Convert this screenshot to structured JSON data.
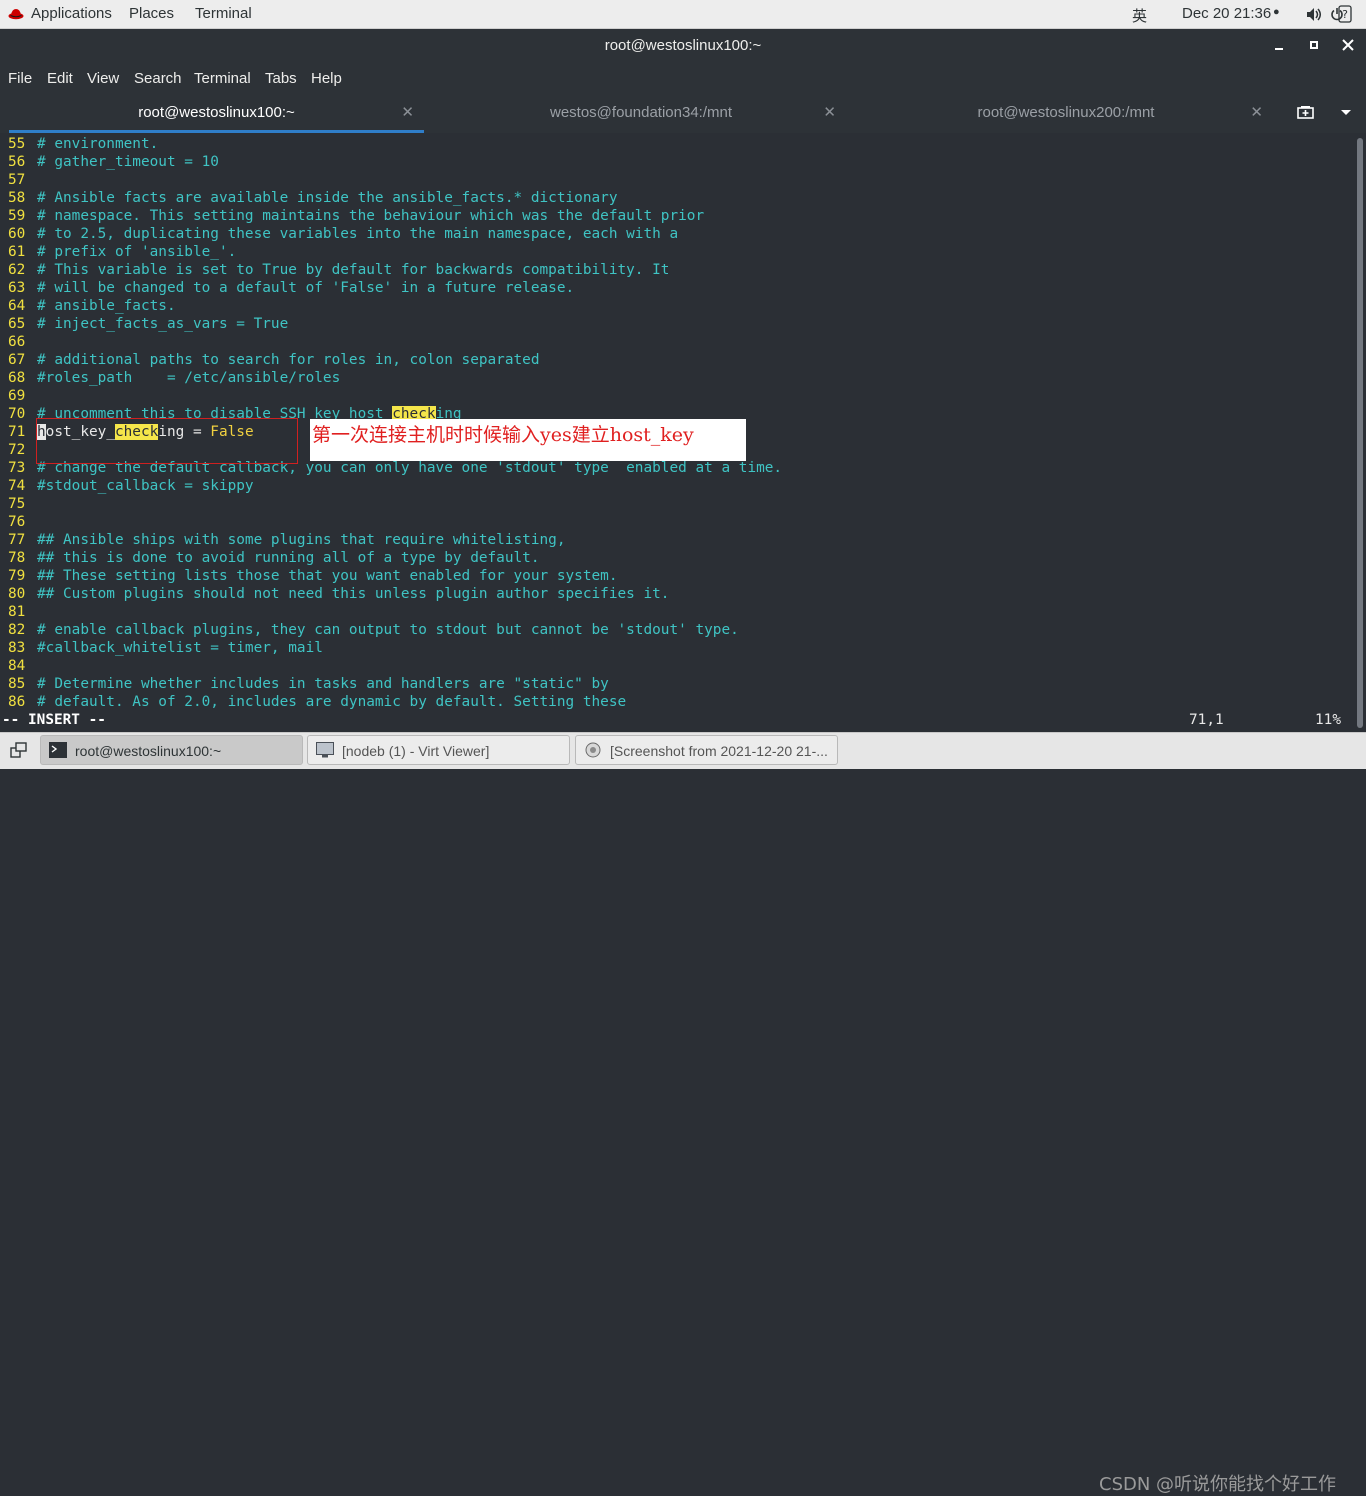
{
  "topbar": {
    "applications": "Applications",
    "places": "Places",
    "terminal": "Terminal",
    "input_method": "英",
    "clock": "Dec 20  21:36",
    "record_dot": "●"
  },
  "window": {
    "title": "root@westoslinux100:~"
  },
  "menu": [
    "File",
    "Edit",
    "View",
    "Search",
    "Terminal",
    "Tabs",
    "Help"
  ],
  "tabs": [
    {
      "label": "root@westoslinux100:~",
      "active": true
    },
    {
      "label": "westos@foundation34:/mnt",
      "active": false
    },
    {
      "label": "root@westoslinux200:/mnt",
      "active": false
    }
  ],
  "editor": {
    "lines": [
      {
        "n": "55",
        "t": "# environment."
      },
      {
        "n": "56",
        "t": "# gather_timeout = 10"
      },
      {
        "n": "57",
        "t": ""
      },
      {
        "n": "58",
        "t": "# Ansible facts are available inside the ansible_facts.* dictionary"
      },
      {
        "n": "59",
        "t": "# namespace. This setting maintains the behaviour which was the default prior"
      },
      {
        "n": "60",
        "t": "# to 2.5, duplicating these variables into the main namespace, each with a"
      },
      {
        "n": "61",
        "t": "# prefix of 'ansible_'."
      },
      {
        "n": "62",
        "t": "# This variable is set to True by default for backwards compatibility. It"
      },
      {
        "n": "63",
        "t": "# will be changed to a default of 'False' in a future release."
      },
      {
        "n": "64",
        "t": "# ansible_facts."
      },
      {
        "n": "65",
        "t": "# inject_facts_as_vars = True"
      },
      {
        "n": "66",
        "t": ""
      },
      {
        "n": "67",
        "t": "# additional paths to search for roles in, colon separated"
      },
      {
        "n": "68",
        "t": "#roles_path    = /etc/ansible/roles"
      },
      {
        "n": "69",
        "t": ""
      },
      {
        "n": "70",
        "t": "# uncomment this to disable SSH key host checking"
      },
      {
        "n": "71",
        "t": "host_key_checking = False"
      },
      {
        "n": "72",
        "t": ""
      },
      {
        "n": "73",
        "t": "# change the default callback, you can only have one 'stdout' type  enabled at a time."
      },
      {
        "n": "74",
        "t": "#stdout_callback = skippy"
      },
      {
        "n": "75",
        "t": ""
      },
      {
        "n": "76",
        "t": ""
      },
      {
        "n": "77",
        "t": "## Ansible ships with some plugins that require whitelisting,"
      },
      {
        "n": "78",
        "t": "## this is done to avoid running all of a type by default."
      },
      {
        "n": "79",
        "t": "## These setting lists those that you want enabled for your system."
      },
      {
        "n": "80",
        "t": "## Custom plugins should not need this unless plugin author specifies it."
      },
      {
        "n": "81",
        "t": ""
      },
      {
        "n": "82",
        "t": "# enable callback plugins, they can output to stdout but cannot be 'stdout' type."
      },
      {
        "n": "83",
        "t": "#callback_whitelist = timer, mail"
      },
      {
        "n": "84",
        "t": ""
      },
      {
        "n": "85",
        "t": "# Determine whether includes in tasks and handlers are \"static\" by"
      },
      {
        "n": "86",
        "t": "# default. As of 2.0, includes are dynamic by default. Setting these"
      }
    ],
    "search_term": "check",
    "mode": "-- INSERT --",
    "position": "71,1",
    "percent": "11%"
  },
  "annotation": {
    "text": "第一次连接主机时时候输入yes建立host_key"
  },
  "taskbar": {
    "items": [
      {
        "label": "root@westoslinux100:~",
        "active": true
      },
      {
        "label": "[nodeb (1) - Virt Viewer]",
        "active": false
      },
      {
        "label": "[Screenshot from 2021-12-20 21-...",
        "active": false
      }
    ],
    "watermark": "CSDN @听说你能找个好工作"
  },
  "colors": {
    "terminal_bg": "#2b2f35",
    "comment": "#3fc4c4",
    "line_number": "#f0e040",
    "search_highlight": "#f5e64a",
    "annotation_red": "#e02020",
    "tab_accent": "#2f7ec9"
  }
}
